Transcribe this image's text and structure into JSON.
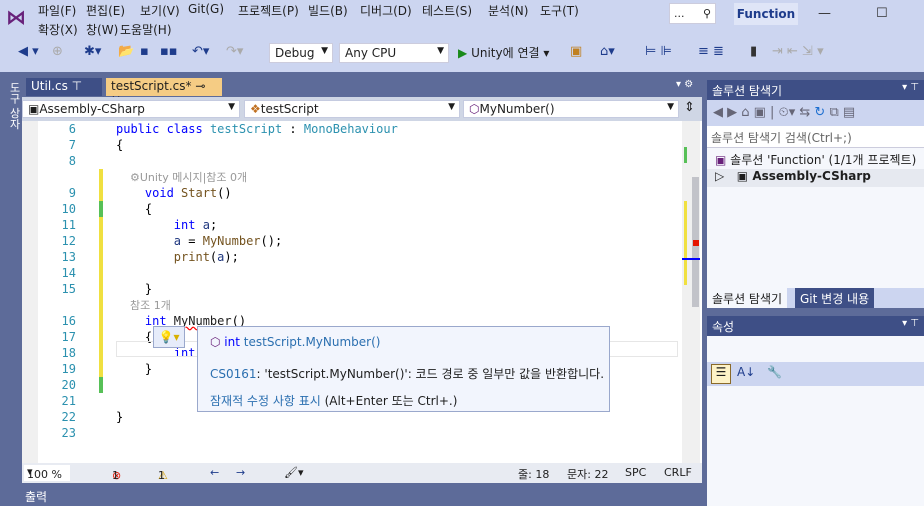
{
  "menu": {
    "row1": [
      "파일(F)",
      "편집(E)",
      "보기(V)",
      "Git(G)",
      "프로젝트(P)",
      "빌드(B)",
      "디버그(D)",
      "테스트(S)",
      "분석(N)",
      "도구(T)"
    ],
    "row2": [
      "확장(X)",
      "창(W)",
      "도움말(H)"
    ],
    "search_placeholder": "...",
    "solution_name": "Function"
  },
  "toolbar": {
    "config": "Debug",
    "platform": "Any CPU",
    "run_label": "Unity에 연결"
  },
  "left_strip": "도구 상자",
  "tabs": [
    {
      "label": "Util.cs",
      "pin": "📌"
    },
    {
      "label": "testScript.cs*",
      "pin": "⊸",
      "close": "✕"
    }
  ],
  "editor_header": {
    "project": "Assembly-CSharp",
    "class": "testScript",
    "member": "MyNumber()"
  },
  "code": [
    {
      "n": "6",
      "t": [
        [
          "public ",
          "kw"
        ],
        [
          "class ",
          "kw"
        ],
        [
          "testScript",
          "ty"
        ],
        [
          " : ",
          "pl"
        ],
        [
          "MonoBehaviour",
          "ty"
        ]
      ]
    },
    {
      "n": "7",
      "t": [
        [
          "{",
          "pl"
        ]
      ]
    },
    {
      "n": "8",
      "t": []
    },
    {
      "n": "",
      "t": [
        [
          "    ⚙Unity 메시지|참조 0개",
          "lens"
        ]
      ]
    },
    {
      "n": "9",
      "t": [
        [
          "    void ",
          "kw"
        ],
        [
          "Start",
          "fn"
        ],
        [
          "()",
          "pl"
        ]
      ]
    },
    {
      "n": "10",
      "t": [
        [
          "    {",
          "pl"
        ]
      ]
    },
    {
      "n": "11",
      "t": [
        [
          "        int ",
          "kw"
        ],
        [
          "a",
          "vr"
        ],
        [
          ";",
          "pl"
        ]
      ]
    },
    {
      "n": "12",
      "t": [
        [
          "        a",
          "vr"
        ],
        [
          " = ",
          "pl"
        ],
        [
          "MyNumber",
          "fn"
        ],
        [
          "();",
          "pl"
        ]
      ]
    },
    {
      "n": "13",
      "t": [
        [
          "        print",
          "fn"
        ],
        [
          "(",
          "pl"
        ],
        [
          "a",
          "vr"
        ],
        [
          ");",
          "pl"
        ]
      ]
    },
    {
      "n": "14",
      "t": []
    },
    {
      "n": "15",
      "t": [
        [
          "    }",
          "pl"
        ]
      ]
    },
    {
      "n": "",
      "t": [
        [
          "    참조 1개",
          "lens"
        ]
      ]
    },
    {
      "n": "16",
      "t": [
        [
          "    int ",
          "kw"
        ],
        [
          "MyNumber",
          "err"
        ],
        [
          "()",
          "pl"
        ]
      ]
    },
    {
      "n": "17",
      "t": [
        [
          "    {",
          "pl"
        ]
      ]
    },
    {
      "n": "18",
      "t": [
        [
          "        int",
          "kw"
        ]
      ]
    },
    {
      "n": "19",
      "t": [
        [
          "    }",
          "pl"
        ]
      ]
    },
    {
      "n": "20",
      "t": []
    },
    {
      "n": "21",
      "t": []
    },
    {
      "n": "22",
      "t": [
        [
          "}",
          "pl"
        ]
      ]
    },
    {
      "n": "23",
      "t": []
    }
  ],
  "tooltip": {
    "sig_type": "int",
    "sig_name": "testScript.MyNumber()",
    "error_code": "CS0161",
    "error_msg": ": 'testScript.MyNumber()': 코드 경로 중 일부만 값을 반환합니다.",
    "fix_link": "잠재적 수정 사항 표시",
    "fix_hint": " (Alt+Enter 또는 Ctrl+.)"
  },
  "status": {
    "zoom": "100 %",
    "errors": "1",
    "warnings": "1",
    "line": "줄: 18",
    "col": "문자: 22",
    "spc": "SPC",
    "eol": "CRLF"
  },
  "output_label": "출력",
  "solution_explorer": {
    "title": "솔루션 탐색기",
    "search_placeholder": "솔루션 탐색기 검색(Ctrl+;)",
    "root": "솔루션 'Function' (1/1개 프로젝트)",
    "project": "Assembly-CSharp",
    "tab1": "솔루션 탐색기",
    "tab2": "Git 변경 내용"
  },
  "properties": {
    "title": "속성"
  }
}
